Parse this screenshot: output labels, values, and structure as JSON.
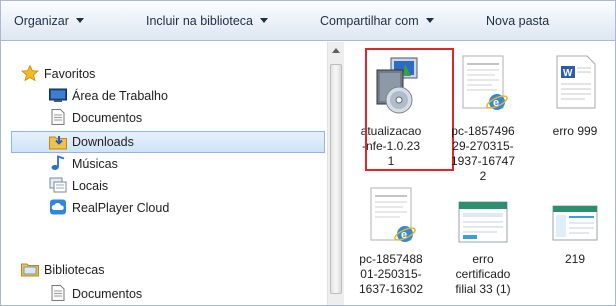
{
  "toolbar": {
    "organize": "Organizar",
    "include": "Incluir na biblioteca",
    "share": "Compartilhar com",
    "new_folder": "Nova pasta"
  },
  "nav": {
    "favorites": "Favoritos",
    "desktop": "Área de Trabalho",
    "documents": "Documentos",
    "downloads": "Downloads",
    "music": "Músicas",
    "places": "Locais",
    "realplayer": "RealPlayer Cloud",
    "libraries": "Bibliotecas",
    "lib_documents": "Documentos"
  },
  "files": [
    {
      "name": "atualizacao\n-nfe-1.0.23\n1",
      "icon": "installer-icon",
      "selected": true
    },
    {
      "name": "pc-1857496\n29-270315-\n1937-16747\n2",
      "icon": "ie-document-icon"
    },
    {
      "name": "erro 999",
      "icon": "word-document-icon"
    },
    {
      "name": "pc-1857488\n01-250315-\n1637-16302",
      "icon": "ie-document-icon"
    },
    {
      "name": "erro\ncertificado\nfilial 33 (1)",
      "icon": "screenshot-icon"
    },
    {
      "name": "219",
      "icon": "screenshot-icon"
    }
  ],
  "colors": {
    "highlight": "#e0262a",
    "selected_bg": "#cfe3f7",
    "toolbar_text": "#1e2f46"
  }
}
